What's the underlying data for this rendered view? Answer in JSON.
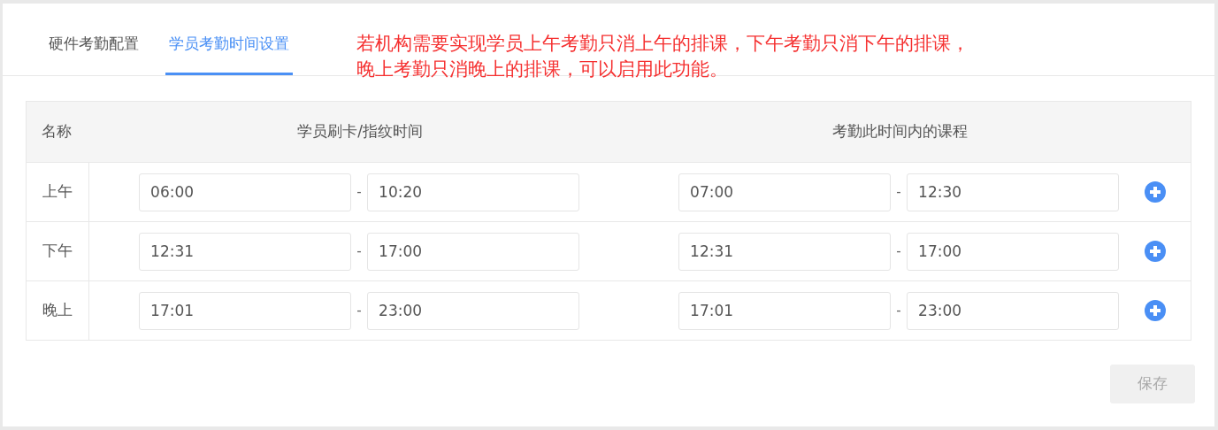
{
  "tabs": [
    {
      "label": "硬件考勤配置",
      "selected": false
    },
    {
      "label": "学员考勤时间设置",
      "selected": true
    }
  ],
  "note": [
    "若机构需要实现学员上午考勤只消上午的排课，下午考勤只消下午的排课，",
    "晚上考勤只消晚上的排课，可以启用此功能。"
  ],
  "table": {
    "columns": [
      "名称",
      "学员刷卡/指纹时间",
      "考勤此时间内的课程"
    ],
    "separator": "-",
    "rows": [
      {
        "name": "上午",
        "punch_start": "06:00",
        "punch_end": "10:20",
        "course_start": "07:00",
        "course_end": "12:30"
      },
      {
        "name": "下午",
        "punch_start": "12:31",
        "punch_end": "17:00",
        "course_start": "12:31",
        "course_end": "17:00"
      },
      {
        "name": "晚上",
        "punch_start": "17:01",
        "punch_end": "23:00",
        "course_start": "17:01",
        "course_end": "23:00"
      }
    ]
  },
  "save_button": {
    "label": "保存",
    "disabled": true
  }
}
